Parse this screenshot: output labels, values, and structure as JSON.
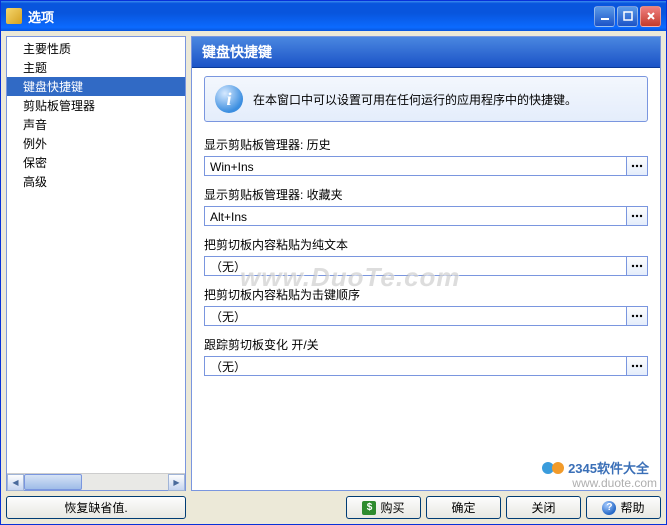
{
  "window": {
    "title": "选项"
  },
  "sidebar": {
    "items": [
      {
        "label": "主要性质"
      },
      {
        "label": "主题"
      },
      {
        "label": "键盘快捷键"
      },
      {
        "label": "剪贴板管理器"
      },
      {
        "label": "声音"
      },
      {
        "label": "例外"
      },
      {
        "label": "保密"
      },
      {
        "label": "高级"
      }
    ],
    "selected_index": 2
  },
  "panel": {
    "title": "键盘快捷键",
    "info_text": "在本窗口中可以设置可用在任何运行的应用程序中的快捷键。"
  },
  "fields": [
    {
      "label": "显示剪贴板管理器: 历史",
      "value": "Win+Ins"
    },
    {
      "label": "显示剪贴板管理器: 收藏夹",
      "value": "Alt+Ins"
    },
    {
      "label": "把剪切板内容粘贴为纯文本",
      "value": "（无）"
    },
    {
      "label": "把剪切板内容粘贴为击键顺序",
      "value": "（无）"
    },
    {
      "label": "跟踪剪切板变化 开/关",
      "value": "（无）"
    }
  ],
  "buttons": {
    "restore_defaults": "恢复缺省值.",
    "buy": "购买",
    "ok": "确定",
    "close": "关闭",
    "help": "帮助"
  },
  "watermark": "www.DuoTe.com",
  "corner_brand": "2345软件大全",
  "corner_url": "www.duote.com"
}
